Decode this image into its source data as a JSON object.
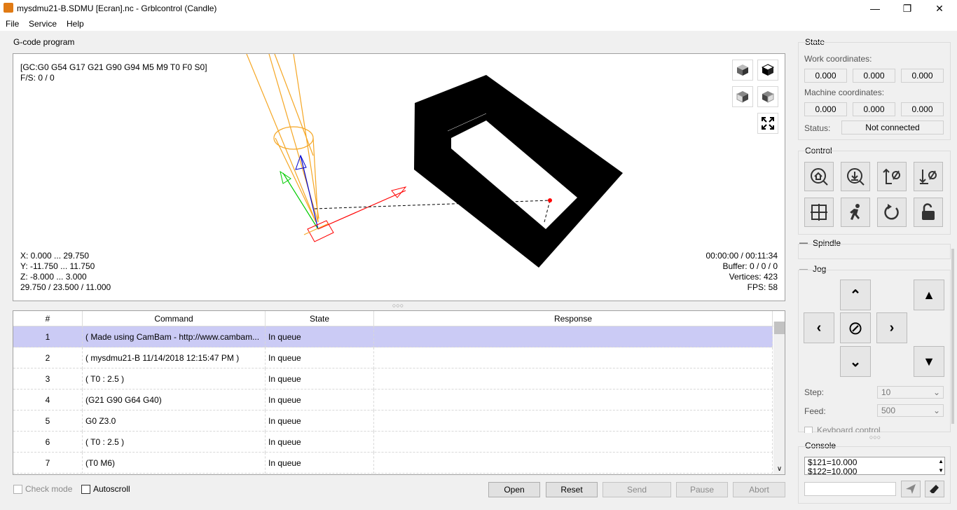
{
  "window": {
    "title": "mysdmu21-B.SDMU [Ecran].nc - Grblcontrol  (Candle)"
  },
  "menu": {
    "file": "File",
    "service": "Service",
    "help": "Help"
  },
  "gcode": {
    "group_title": "G-code program",
    "gc_line": "[GC:G0 G54 G17 G21 G90 G94 M5 M9 T0 F0 S0]",
    "fs_line": "F/S: 0 / 0",
    "x_range": "X: 0.000 ... 29.750",
    "y_range": "Y: -11.750 ... 11.750",
    "z_range": "Z: -8.000 ... 3.000",
    "size": "29.750 / 23.500 / 11.000",
    "time": "00:00:00 / 00:11:34",
    "buffer": "Buffer: 0 / 0 / 0",
    "vertices": "Vertices: 423",
    "fps": "FPS: 58",
    "view_icons": [
      "cube-iso-icon",
      "cube-top-icon",
      "cube-front-icon",
      "cube-left-icon",
      "fit-icon"
    ]
  },
  "table": {
    "headers": [
      "#",
      "Command",
      "State",
      "Response"
    ],
    "rows": [
      {
        "num": "1",
        "command": "( Made using CamBam - http://www.cambam...",
        "state": "In queue",
        "response": ""
      },
      {
        "num": "2",
        "command": "( mysdmu21-B 11/14/2018 12:15:47 PM )",
        "state": "In queue",
        "response": ""
      },
      {
        "num": "3",
        "command": "( T0 : 2.5 )",
        "state": "In queue",
        "response": ""
      },
      {
        "num": "4",
        "command": "(G21 G90 G64 G40)",
        "state": "In queue",
        "response": ""
      },
      {
        "num": "5",
        "command": "G0 Z3.0",
        "state": "In queue",
        "response": ""
      },
      {
        "num": "6",
        "command": "( T0 : 2.5 )",
        "state": "In queue",
        "response": ""
      },
      {
        "num": "7",
        "command": "(T0 M6)",
        "state": "In queue",
        "response": ""
      }
    ]
  },
  "bottom": {
    "check_mode": "Check mode",
    "autoscroll": "Autoscroll",
    "open": "Open",
    "reset": "Reset",
    "send": "Send",
    "pause": "Pause",
    "abort": "Abort"
  },
  "state": {
    "title": "State",
    "work_label": "Work coordinates:",
    "work": [
      "0.000",
      "0.000",
      "0.000"
    ],
    "machine_label": "Machine coordinates:",
    "machine": [
      "0.000",
      "0.000",
      "0.000"
    ],
    "status_label": "Status:",
    "status": "Not connected"
  },
  "control": {
    "title": "Control"
  },
  "spindle": {
    "title": "Spindle"
  },
  "jog": {
    "title": "Jog",
    "step_label": "Step:",
    "step": "10",
    "feed_label": "Feed:",
    "feed": "500",
    "keyboard": "Keyboard control"
  },
  "console": {
    "title": "Console",
    "lines": [
      "$121=10.000",
      "$122=10.000"
    ]
  },
  "colors": {
    "selection": "#cbcbf5",
    "tool": "#f5a623",
    "axis_x": "#ff0000",
    "axis_y": "#00cc00",
    "axis_z": "#0000cc"
  }
}
